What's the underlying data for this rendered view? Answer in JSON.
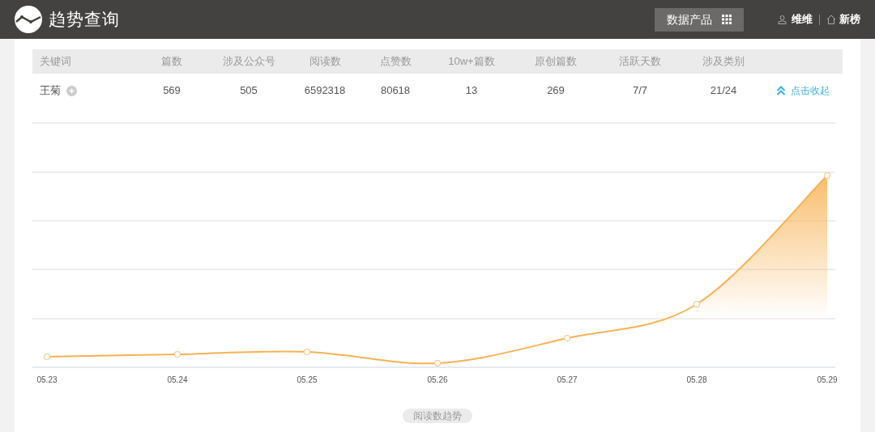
{
  "header": {
    "title": "趋势查询",
    "products_button": "数据产品",
    "user": "维维",
    "site": "新榜"
  },
  "table": {
    "columns": [
      "关键词",
      "篇数",
      "涉及公众号",
      "阅读数",
      "点赞数",
      "10w+篇数",
      "原创篇数",
      "活跃天数",
      "涉及类别"
    ],
    "rows": [
      {
        "cells": [
          "王菊",
          "569",
          "505",
          "6592318",
          "80618",
          "13",
          "269",
          "7/7",
          "21/24"
        ],
        "action": "点击收起"
      }
    ]
  },
  "chart": {
    "x_labels": [
      "05.23",
      "05.24",
      "05.25",
      "05.26",
      "05.27",
      "05.28",
      "05.29"
    ],
    "legend": "阅读数趋势"
  }
}
